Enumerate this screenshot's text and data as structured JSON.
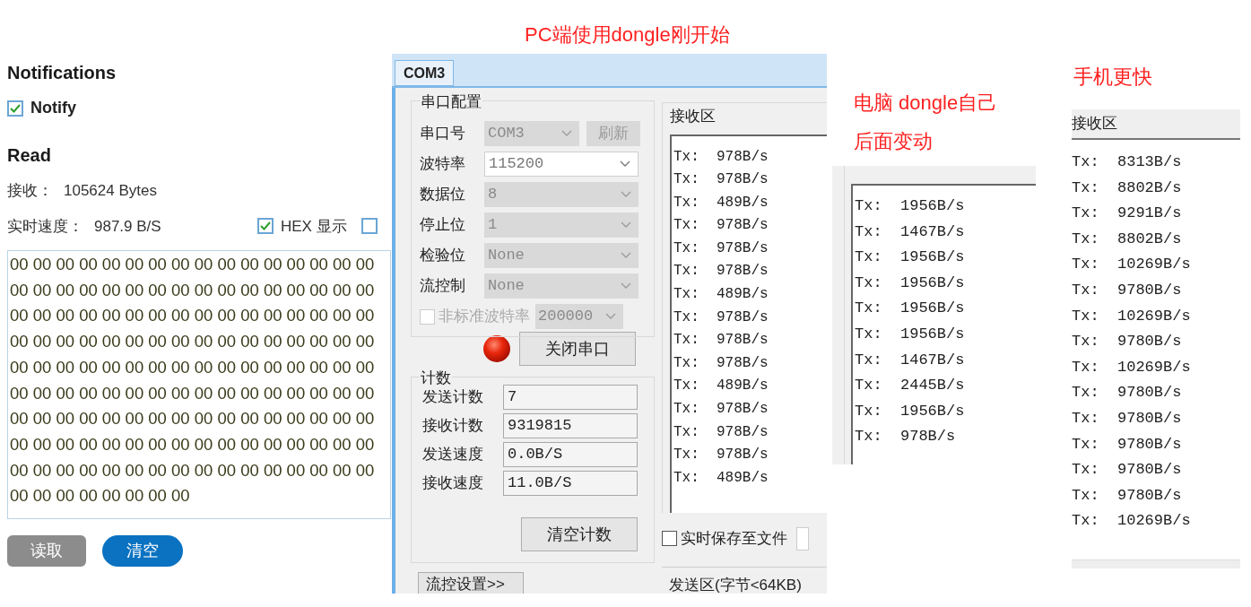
{
  "annotations": [
    "PC端使用dongle刚开始",
    "电脑 dongle自己",
    "后面变动",
    "手机更快"
  ],
  "ble_panel": {
    "notifications_title": "Notifications",
    "notify": {
      "label": "Notify",
      "checked": true
    },
    "read_title": "Read",
    "received": {
      "label": "接收：",
      "value": "105624 Bytes"
    },
    "speed": {
      "label": "实时速度：",
      "value": "987.9 B/S"
    },
    "hex_display": {
      "label": "HEX 显示",
      "checked": true
    },
    "option_2": {
      "checked": false
    },
    "data_lines": [
      "00 00 00 00 00 00 00 00 00 00 00 00 00 00 00 00",
      "00 00 00 00 00 00 00 00 00 00 00 00 00 00 00 00",
      "00 00 00 00 00 00 00 00 00 00 00 00 00 00 00 00",
      "00 00 00 00 00 00 00 00 00 00 00 00 00 00 00 00",
      "00 00 00 00 00 00 00 00 00 00 00 00 00 00 00 00",
      "00 00 00 00 00 00 00 00 00 00 00 00 00 00 00 00",
      "00 00 00 00 00 00 00 00 00 00 00 00 00 00 00 00",
      "00 00 00 00 00 00 00 00 00 00 00 00 00 00 00 00",
      "00 00 00 00 00 00 00 00 00 00 00 00 00 00 00 00",
      "00 00 00 00 00 00 00 00"
    ],
    "buttons": [
      {
        "label": "读取",
        "kind": "secondary"
      },
      {
        "label": "清空",
        "kind": "primary"
      }
    ]
  },
  "serial_tool": {
    "tab": "COM3",
    "config_title": "串口配置",
    "fields": [
      {
        "label": "串口号",
        "value": "COM3",
        "disabled": true
      },
      {
        "label": "波特率",
        "value": "115200",
        "disabled": false
      },
      {
        "label": "数据位",
        "value": "8",
        "disabled": true
      },
      {
        "label": "停止位",
        "value": "1",
        "disabled": true
      },
      {
        "label": "检验位",
        "value": "None",
        "disabled": true
      },
      {
        "label": "流控制",
        "value": "None",
        "disabled": true
      }
    ],
    "refresh_button": {
      "label": "刷新",
      "disabled": true
    },
    "custom_baud": {
      "label": "非标准波特率",
      "checked": false,
      "value": "200000"
    },
    "close_button": "关闭串口",
    "counts_title": "计数",
    "counters": [
      {
        "label": "发送计数",
        "value": "7"
      },
      {
        "label": "接收计数",
        "value": "9319815"
      },
      {
        "label": "发送速度",
        "value": "0.0B/S"
      },
      {
        "label": "接收速度",
        "value": "11.0B/S"
      }
    ],
    "clear_button": "清空计数",
    "flow_button": "流控设置>>",
    "receive_title": "接收区",
    "receive_lines": [
      "Tx:  978B/s",
      "Tx:  978B/s",
      "Tx:  489B/s",
      "Tx:  978B/s",
      "Tx:  978B/s",
      "Tx:  978B/s",
      "Tx:  489B/s",
      "Tx:  978B/s",
      "Tx:  978B/s",
      "Tx:  978B/s",
      "Tx:  489B/s",
      "Tx:  978B/s",
      "Tx:  978B/s",
      "Tx:  978B/s",
      "Tx:  489B/s"
    ],
    "save_to_file": {
      "label": "实时保存至文件",
      "checked": false
    },
    "send_title": "发送区(字节<64KB)"
  },
  "pc_log": {
    "lines": [
      "Tx:  1956B/s",
      "Tx:  1467B/s",
      "Tx:  1956B/s",
      "Tx:  1956B/s",
      "Tx:  1956B/s",
      "Tx:  1956B/s",
      "Tx:  1467B/s",
      "Tx:  2445B/s",
      "Tx:  1956B/s",
      "Tx:  978B/s"
    ]
  },
  "phone_log": {
    "title": "接收区",
    "lines": [
      "Tx:  8313B/s",
      "Tx:  8802B/s",
      "Tx:  9291B/s",
      "Tx:  8802B/s",
      "Tx:  10269B/s",
      "Tx:  9780B/s",
      "Tx:  10269B/s",
      "Tx:  9780B/s",
      "Tx:  10269B/s",
      "Tx:  9780B/s",
      "Tx:  9780B/s",
      "Tx:  9780B/s",
      "Tx:  9780B/s",
      "Tx:  9780B/s",
      "Tx:  10269B/s"
    ]
  }
}
